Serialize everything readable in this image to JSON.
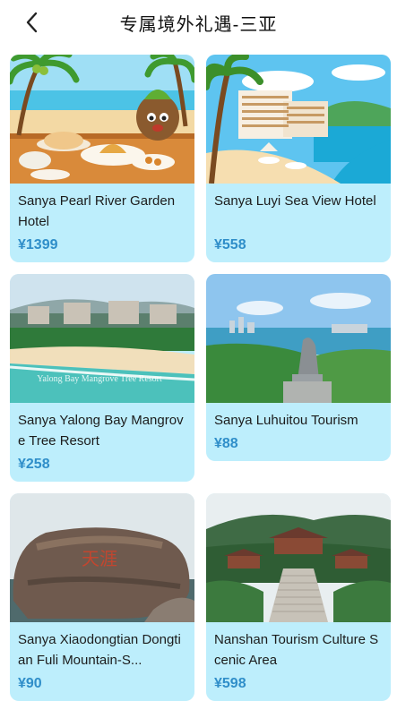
{
  "header": {
    "title": "专属境外礼遇-三亚"
  },
  "cards": [
    {
      "name": "Sanya Pearl River Garden Hotel",
      "price": "¥1399",
      "image": "hotel-breakfast-illustration"
    },
    {
      "name": "Sanya Luyi Sea View Hotel",
      "price": "¥558",
      "image": "seaview-hotel-illustration"
    },
    {
      "name": "Sanya Yalong Bay Mangrove Tree Resort",
      "price": "¥258",
      "image": "resort-beach-photo",
      "image_caption": "Yalong Bay Mangrove Tree Resort"
    },
    {
      "name": "Sanya Luhuitou Tourism",
      "price": "¥88",
      "image": "luhuitou-statue-photo"
    },
    {
      "name": "Sanya Xiaodongtian Dongtian Fuli Mountain-S...",
      "price": "¥90",
      "image": "carved-rock-photo",
      "image_caption": "天涯"
    },
    {
      "name": "Nanshan Tourism Culture Scenic Area",
      "price": "¥598",
      "image": "temple-gate-photo"
    }
  ]
}
